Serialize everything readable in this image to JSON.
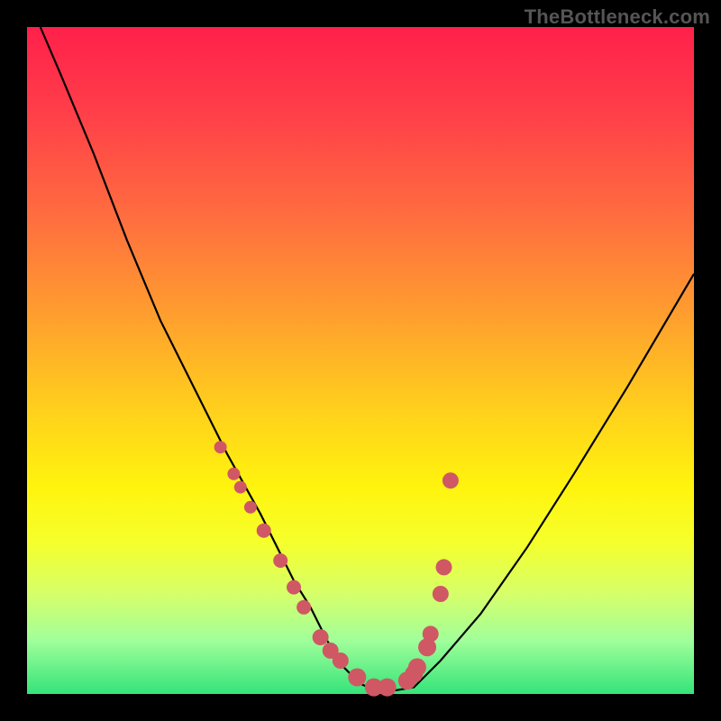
{
  "watermark": "TheBottleneck.com",
  "chart_data": {
    "type": "line",
    "title": "",
    "xlabel": "",
    "ylabel": "",
    "xlim": [
      0,
      100
    ],
    "ylim": [
      0,
      100
    ],
    "series": [
      {
        "name": "curve",
        "x": [
          2,
          5,
          10,
          15,
          20,
          25,
          30,
          35,
          40,
          42.5,
          45,
          47.5,
          50,
          52.5,
          55,
          58,
          62,
          68,
          75,
          82,
          90,
          100
        ],
        "y": [
          100,
          93,
          81,
          68,
          56,
          46,
          36,
          27,
          17,
          13,
          8,
          4,
          1.5,
          0.5,
          0.5,
          1,
          5,
          12,
          22,
          33,
          46,
          63
        ]
      }
    ],
    "markers": {
      "name": "markers",
      "color": "#cf5864",
      "x": [
        29,
        31,
        32,
        33.5,
        35.5,
        38,
        40,
        41.5,
        44,
        45.5,
        47,
        49.5,
        52,
        54,
        57,
        58,
        58.5,
        60,
        60.5,
        62,
        62.5,
        63.5
      ],
      "y": [
        37,
        33,
        31,
        28,
        24.5,
        20,
        16,
        13,
        8.5,
        6.5,
        5,
        2.5,
        1,
        1,
        2,
        3,
        4,
        7,
        9,
        15,
        19,
        32
      ],
      "radius": [
        7,
        7,
        7,
        7,
        8,
        8,
        8,
        8,
        9,
        9,
        9,
        10,
        10,
        10,
        10,
        10,
        10,
        10,
        9,
        9,
        9,
        9
      ]
    }
  }
}
